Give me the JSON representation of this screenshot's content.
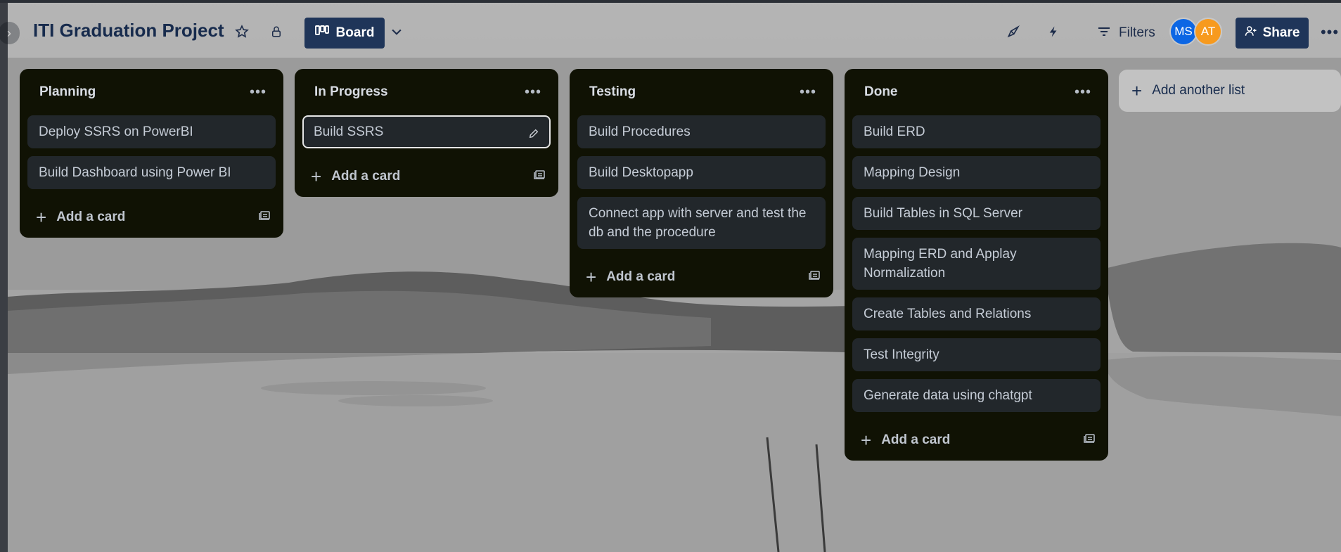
{
  "header": {
    "board_title": "ITI Graduation Project",
    "view_label": "Board",
    "filters_label": "Filters",
    "share_label": "Share",
    "members": [
      {
        "initials": "MS",
        "color": "#0c66e4"
      },
      {
        "initials": "AT",
        "color": "#f79a1e"
      }
    ],
    "icons": [
      "star-icon",
      "lock-icon",
      "board-icon",
      "chevron-down-icon",
      "rocket-icon",
      "lightning-icon",
      "filter-icon",
      "share-person-icon",
      "more-icon"
    ]
  },
  "lists": [
    {
      "title": "Planning",
      "cards": [
        "Deploy SSRS on PowerBI",
        "Build Dashboard using Power BI"
      ],
      "add_card_label": "Add a card"
    },
    {
      "title": "In Progress",
      "cards": [
        "Build SSRS"
      ],
      "add_card_label": "Add a card"
    },
    {
      "title": "Testing",
      "cards": [
        "Build Procedures",
        "Build Desktopapp",
        "Connect app with server and test the db and the procedure"
      ],
      "add_card_label": "Add a card"
    },
    {
      "title": "Done",
      "cards": [
        "Build ERD",
        "Mapping Design",
        "Build Tables in SQL Server",
        "Mapping ERD and Applay Normalization",
        "Create Tables and Relations",
        "Test Integrity",
        "Generate data using chatgpt"
      ],
      "add_card_label": "Add a card"
    }
  ],
  "add_list_label": "Add another list",
  "colors": {
    "list_bg": "#101204",
    "card_bg": "#22272b",
    "accent_button": "#1f3559"
  }
}
